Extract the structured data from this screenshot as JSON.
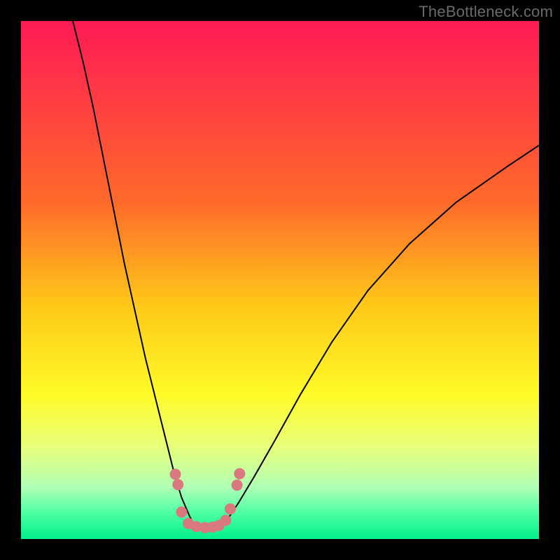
{
  "watermark": "TheBottleneck.com",
  "chart_data": {
    "type": "line",
    "title": "",
    "xlabel": "",
    "ylabel": "",
    "xlim": [
      0,
      100
    ],
    "ylim": [
      0,
      100
    ],
    "background_gradient": {
      "stops": [
        {
          "offset": 0.0,
          "color": "#ff1a55"
        },
        {
          "offset": 0.35,
          "color": "#ff6a2a"
        },
        {
          "offset": 0.55,
          "color": "#ffc919"
        },
        {
          "offset": 0.72,
          "color": "#fffb28"
        },
        {
          "offset": 0.82,
          "color": "#e9ff79"
        },
        {
          "offset": 0.9,
          "color": "#b0ffb5"
        },
        {
          "offset": 0.95,
          "color": "#4dffa3"
        },
        {
          "offset": 1.0,
          "color": "#00f08c"
        }
      ]
    },
    "series": [
      {
        "name": "curve-left",
        "x": [
          10.0,
          12.0,
          14.0,
          16.0,
          18.0,
          20.0,
          22.0,
          24.0,
          26.0,
          28.0,
          29.5,
          31.0,
          32.5,
          33.5
        ],
        "y": [
          100.0,
          92.0,
          83.0,
          73.0,
          63.0,
          53.0,
          44.0,
          35.0,
          27.0,
          19.0,
          13.0,
          8.0,
          4.5,
          2.5
        ]
      },
      {
        "name": "curve-right",
        "x": [
          38.5,
          40.0,
          42.0,
          45.0,
          49.0,
          54.0,
          60.0,
          67.0,
          75.0,
          84.0,
          94.0,
          100.0
        ],
        "y": [
          2.5,
          4.0,
          7.0,
          12.0,
          19.0,
          28.0,
          38.0,
          48.0,
          57.0,
          65.0,
          72.0,
          76.0
        ]
      }
    ],
    "markers": {
      "color": "#d9787e",
      "radius": 8,
      "points": [
        {
          "x": 29.8,
          "y": 12.5
        },
        {
          "x": 30.3,
          "y": 10.5
        },
        {
          "x": 31.0,
          "y": 5.2
        },
        {
          "x": 32.3,
          "y": 3.0
        },
        {
          "x": 33.8,
          "y": 2.4
        },
        {
          "x": 35.5,
          "y": 2.2
        },
        {
          "x": 37.0,
          "y": 2.3
        },
        {
          "x": 38.2,
          "y": 2.6
        },
        {
          "x": 39.5,
          "y": 3.6
        },
        {
          "x": 40.4,
          "y": 5.8
        },
        {
          "x": 41.7,
          "y": 10.4
        },
        {
          "x": 42.2,
          "y": 12.6
        }
      ]
    }
  }
}
